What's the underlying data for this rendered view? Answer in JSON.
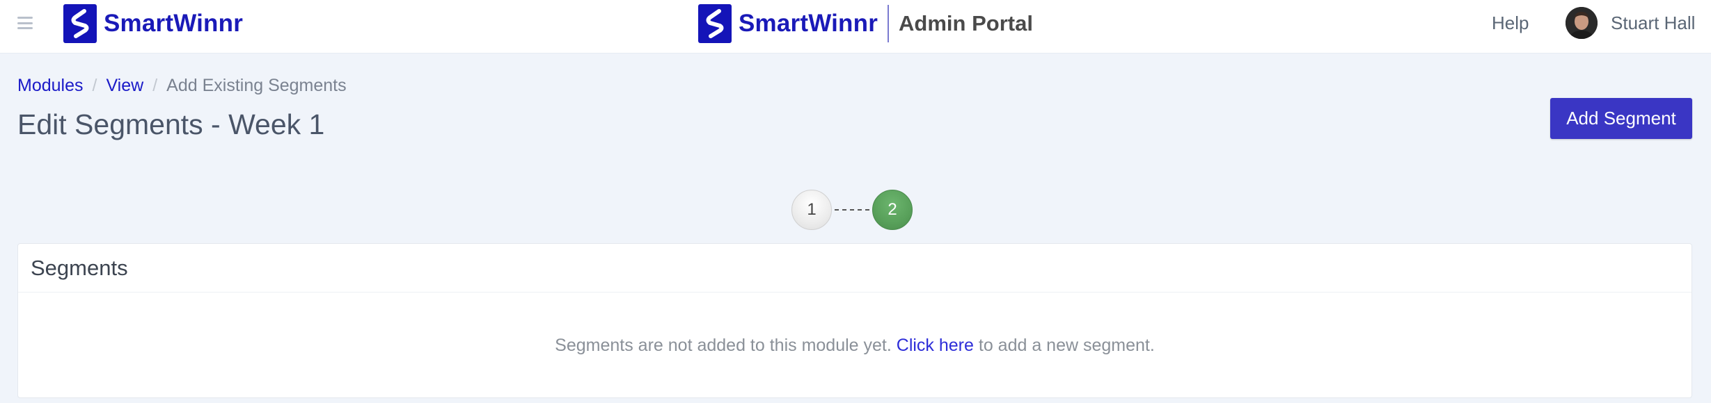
{
  "header": {
    "brand_name": "SmartWinnr",
    "portal_title": "Admin Portal",
    "help_label": "Help",
    "user_name": "Stuart Hall",
    "brand_color": "#1414b8",
    "menu_icon": "hamburger-menu-icon"
  },
  "breadcrumb": {
    "items": [
      "Modules",
      "View"
    ],
    "separator": "/",
    "current": "Add Existing Segments"
  },
  "page": {
    "title": "Edit Segments - Week 1",
    "add_segment_label": "Add Segment",
    "primary_color": "#3a36c4"
  },
  "stepper": {
    "steps": [
      {
        "label": "1",
        "state": "completed",
        "color": "#ececec"
      },
      {
        "label": "2",
        "state": "active",
        "color": "#58a05a"
      }
    ],
    "connector": "-----"
  },
  "segments": {
    "title": "Segments",
    "empty_prefix": "Segments are not added to this module yet.",
    "empty_link": "Click here",
    "empty_suffix": "to add a new segment."
  }
}
